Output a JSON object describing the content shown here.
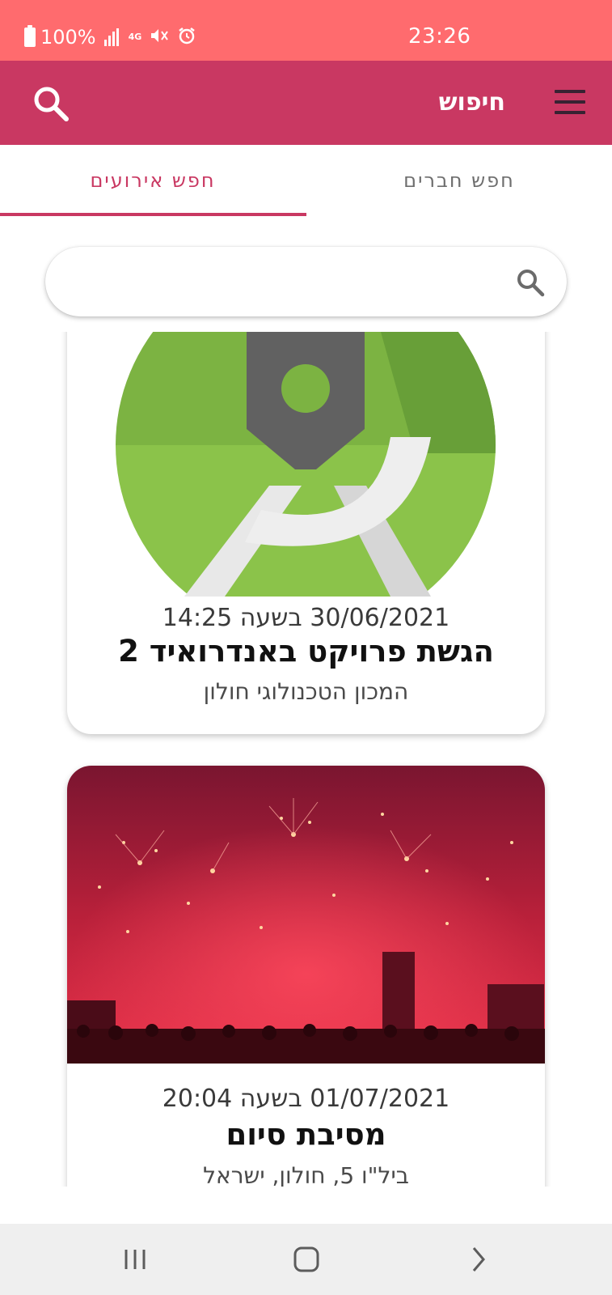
{
  "status_bar": {
    "battery": "100%",
    "network": "4G",
    "time": "23:26",
    "icons": [
      "battery-icon",
      "signal-icon",
      "network-4g-icon",
      "mute-icon",
      "alarm-icon"
    ]
  },
  "app_bar": {
    "title": "חיפוש",
    "icons": [
      "search-icon",
      "menu-icon"
    ],
    "background": "#c93862"
  },
  "tabs": [
    {
      "label": "חפש אירועים",
      "selected": true
    },
    {
      "label": "חפש חברים",
      "selected": false
    }
  ],
  "search": {
    "value": "",
    "placeholder": ""
  },
  "events": [
    {
      "datetime": "30/06/2021 בשעה 14:25",
      "name": "הגשת פרויקט באנדרואיד 2",
      "location": "המכון הטכנולוגי חולון",
      "image": "android-studio-logo"
    },
    {
      "datetime": "01/07/2021 בשעה 20:04",
      "name": "מסיבת סיום",
      "location": "ביל\"ו 5, חולון, ישראל",
      "image": "fireworks-concert-photo"
    }
  ],
  "nav_bar": {
    "buttons": [
      "recent-apps-icon",
      "home-icon",
      "back-icon"
    ]
  },
  "colors": {
    "status_bar": "#ff6b6e",
    "accent": "#c93862"
  }
}
